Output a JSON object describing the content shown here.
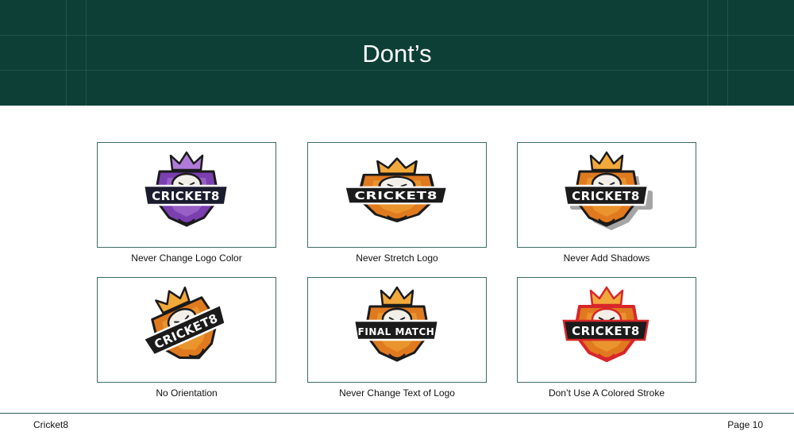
{
  "slide": {
    "title": "Dont’s"
  },
  "cards": [
    {
      "caption": "Never Change Logo Color",
      "wordmark": "CRICKET8",
      "colors": {
        "primary": "#7b3fb0",
        "accent": "#b07ad8",
        "stroke": "#1a1a1a",
        "banner": "#1b1b2e"
      }
    },
    {
      "caption": "Never Stretch Logo",
      "wordmark": "CRICKET8",
      "colors": {
        "primary": "#e07a1f",
        "accent": "#f2a93b",
        "stroke": "#1a1a1a",
        "banner": "#1b1b1b"
      }
    },
    {
      "caption": "Never Add Shadows",
      "wordmark": "CRICKET8",
      "colors": {
        "primary": "#e07a1f",
        "accent": "#f2a93b",
        "stroke": "#1a1a1a",
        "banner": "#1b1b1b"
      }
    },
    {
      "caption": "No Orientation",
      "wordmark": "CRICKET8",
      "colors": {
        "primary": "#e07a1f",
        "accent": "#f2a93b",
        "stroke": "#1a1a1a",
        "banner": "#1b1b1b"
      }
    },
    {
      "caption": "Never Change Text of Logo",
      "wordmark": "FINAL MATCH",
      "colors": {
        "primary": "#e07a1f",
        "accent": "#f2a93b",
        "stroke": "#1a1a1a",
        "banner": "#1b1b1b"
      }
    },
    {
      "caption": "Don’t Use A Colored Stroke",
      "wordmark": "CRICKET8",
      "colors": {
        "primary": "#e07a1f",
        "accent": "#f2a93b",
        "stroke": "#d8262a",
        "banner": "#1b1b1b"
      }
    }
  ],
  "footer": {
    "brand": "Cricket8",
    "page": "Page 10"
  },
  "theme": {
    "header_bg": "#0d3f36",
    "card_border": "#3c6b64"
  }
}
